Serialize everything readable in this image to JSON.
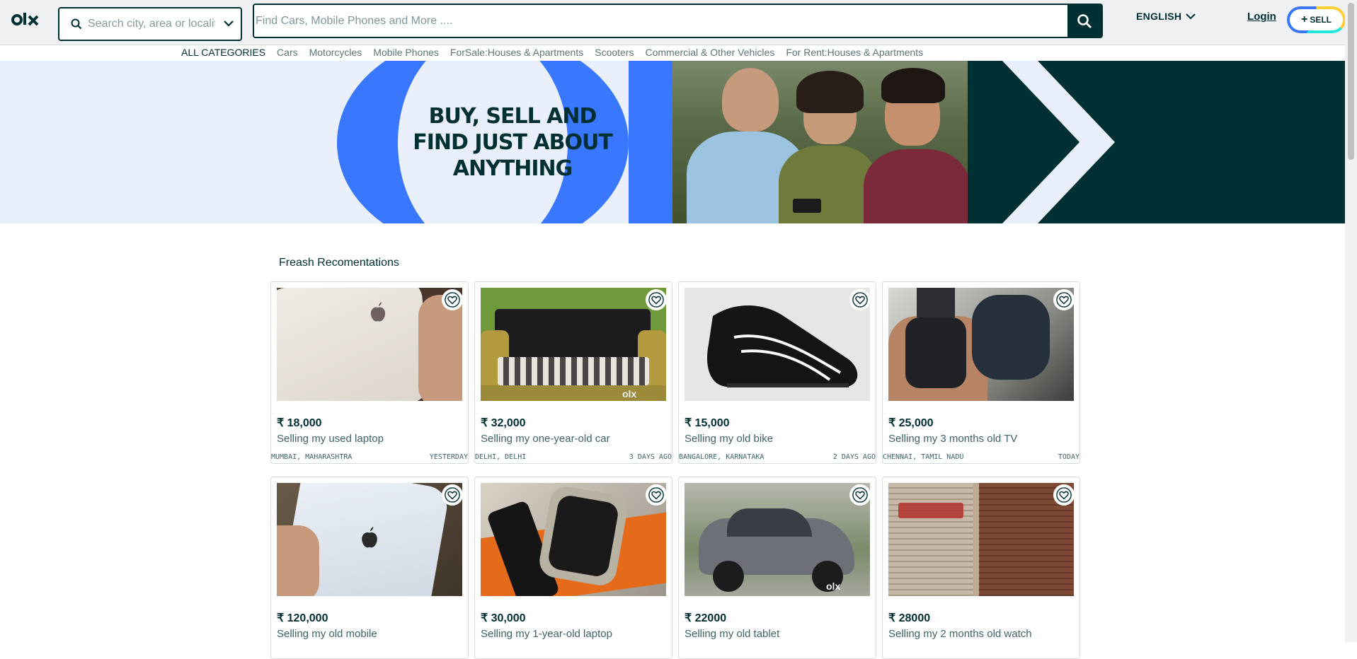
{
  "header": {
    "logo": "olx",
    "location_placeholder": "Search city, area or locality",
    "search_placeholder": "Find Cars, Mobile Phones and More ....",
    "language": "ENGLISH",
    "login": "Login",
    "sell": "SELL"
  },
  "categories": {
    "all": "ALL CATEGORIES",
    "items": [
      "Cars",
      "Motorcycles",
      "Mobile Phones",
      "ForSale:Houses & Apartments",
      "Scooters",
      "Commercial & Other Vehicles",
      "For Rent:Houses & Apartments"
    ]
  },
  "banner": {
    "line1": "BUY, SELL AND",
    "line2": "FIND JUST ABOUT",
    "line3": "ANYTHING"
  },
  "section": {
    "title": "Freash Recomentations"
  },
  "listings": [
    {
      "price": "₹ 18,000",
      "title": "Selling my used laptop",
      "location": "MUMBAI, MAHARASHTRA",
      "date": "YESTERDAY",
      "image": "white-phone"
    },
    {
      "price": "₹ 32,000",
      "title": "Selling my one-year-old car",
      "location": "DELHI, DELHI",
      "date": "3 DAYS AGO",
      "image": "sofa"
    },
    {
      "price": "₹ 15,000",
      "title": "Selling my old bike",
      "location": "BANGALORE, KARNATAKA",
      "date": "2 DAYS AGO",
      "image": "black-shoe"
    },
    {
      "price": "₹ 25,000",
      "title": "Selling my 3 months old TV",
      "location": "CHENNAI, TAMIL NADU",
      "date": "TODAY",
      "image": "smartwatch-airpods"
    },
    {
      "price": "₹ 120,000",
      "title": "Selling my old mobile",
      "location": "",
      "date": "",
      "image": "white-iphone"
    },
    {
      "price": "₹ 30,000",
      "title": "Selling my 1-year-old laptop",
      "location": "",
      "date": "",
      "image": "smartwatch"
    },
    {
      "price": "₹ 22000",
      "title": "Selling my old tablet",
      "location": "",
      "date": "",
      "image": "grey-car"
    },
    {
      "price": "₹ 28000",
      "title": "Selling my 2 months old watch",
      "location": "",
      "date": "",
      "image": "shop-shutter"
    }
  ],
  "colors": {
    "brand_dark": "#002f34",
    "banner_blue": "#3a77ff",
    "banner_light": "#e9f0fc"
  }
}
